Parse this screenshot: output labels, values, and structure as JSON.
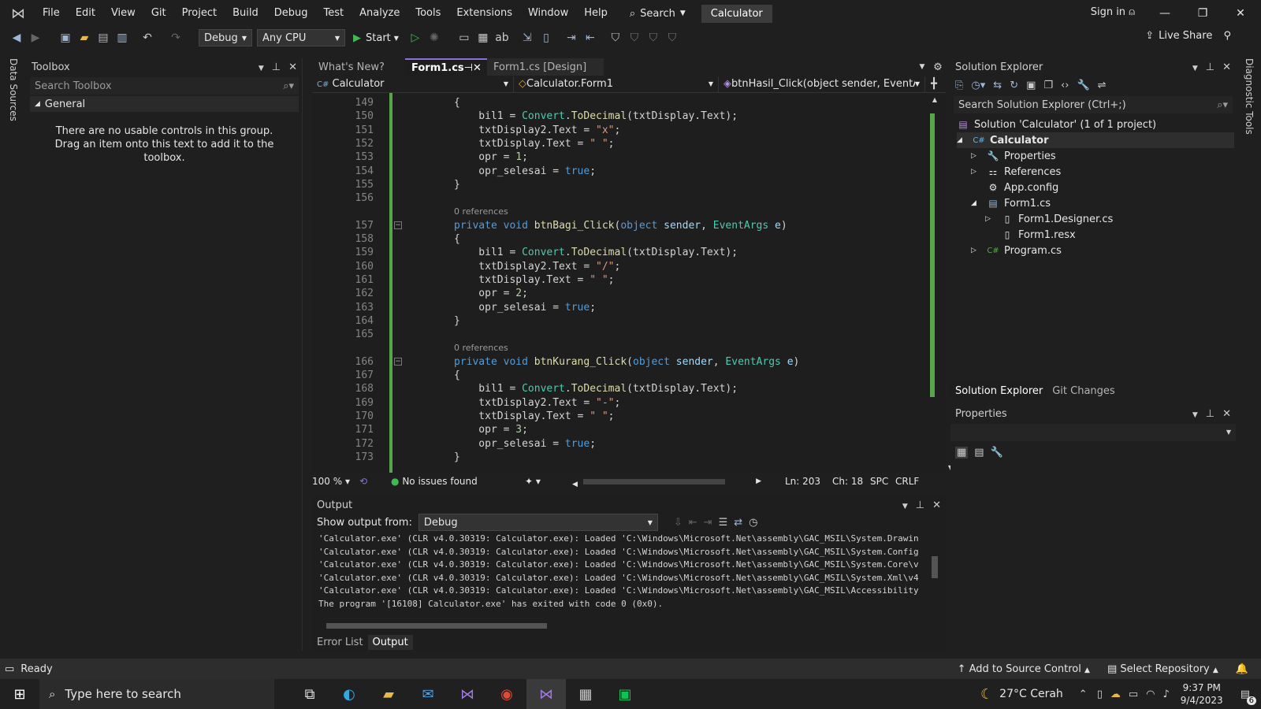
{
  "titlebar": {
    "menu": [
      "File",
      "Edit",
      "View",
      "Git",
      "Project",
      "Build",
      "Debug",
      "Test",
      "Analyze",
      "Tools",
      "Extensions",
      "Window",
      "Help"
    ],
    "search_label": "Search",
    "app_name": "Calculator",
    "sign_in": "Sign in"
  },
  "toolbar": {
    "config": "Debug",
    "platform": "Any CPU",
    "start": "Start",
    "live_share": "Live Share"
  },
  "side_strips": {
    "left": "Data Sources",
    "right": "Diagnostic Tools"
  },
  "toolbox": {
    "title": "Toolbox",
    "search_placeholder": "Search Toolbox",
    "group": "General",
    "message": "There are no usable controls in this group. Drag an item onto this text to add it to the toolbox."
  },
  "editor": {
    "tabs": [
      {
        "label": "What's New?"
      },
      {
        "label": "Form1.cs"
      },
      {
        "label": "Form1.cs [Design]"
      }
    ],
    "nav": {
      "project": "Calculator",
      "class": "Calculator.Form1",
      "member": "btnHasil_Click(object sender, EventArgs"
    },
    "code_lines": [
      {
        "n": "149",
        "t": "{"
      },
      {
        "n": "150",
        "t": "    bil1 = Convert.ToDecimal(txtDisplay.Text);"
      },
      {
        "n": "151",
        "t": "    txtDisplay2.Text = \"x\";"
      },
      {
        "n": "152",
        "t": "    txtDisplay.Text = \" \";"
      },
      {
        "n": "153",
        "t": "    opr = 1;"
      },
      {
        "n": "154",
        "t": "    opr_selesai = true;"
      },
      {
        "n": "155",
        "t": "}"
      },
      {
        "n": "156",
        "t": ""
      },
      {
        "n": "",
        "t": "0 references"
      },
      {
        "n": "157",
        "t": "private void btnBagi_Click(object sender, EventArgs e)"
      },
      {
        "n": "158",
        "t": "{"
      },
      {
        "n": "159",
        "t": "    bil1 = Convert.ToDecimal(txtDisplay.Text);"
      },
      {
        "n": "160",
        "t": "    txtDisplay2.Text = \"/\";"
      },
      {
        "n": "161",
        "t": "    txtDisplay.Text = \" \";"
      },
      {
        "n": "162",
        "t": "    opr = 2;"
      },
      {
        "n": "163",
        "t": "    opr_selesai = true;"
      },
      {
        "n": "164",
        "t": "}"
      },
      {
        "n": "165",
        "t": ""
      },
      {
        "n": "",
        "t": "0 references"
      },
      {
        "n": "166",
        "t": "private void btnKurang_Click(object sender, EventArgs e)"
      },
      {
        "n": "167",
        "t": "{"
      },
      {
        "n": "168",
        "t": "    bil1 = Convert.ToDecimal(txtDisplay.Text);"
      },
      {
        "n": "169",
        "t": "    txtDisplay2.Text = \"-\";"
      },
      {
        "n": "170",
        "t": "    txtDisplay.Text = \" \";"
      },
      {
        "n": "171",
        "t": "    opr = 3;"
      },
      {
        "n": "172",
        "t": "    opr_selesai = true;"
      },
      {
        "n": "173",
        "t": "}"
      }
    ],
    "status": {
      "zoom": "100 %",
      "issues": "No issues found",
      "ln": "Ln: 203",
      "ch": "Ch: 18",
      "spc": "SPC",
      "eol": "CRLF"
    }
  },
  "solution_explorer": {
    "title": "Solution Explorer",
    "search_placeholder": "Search Solution Explorer (Ctrl+;)",
    "items": [
      {
        "label": "Solution 'Calculator' (1 of 1 project)",
        "icon": "solution-icon",
        "expander": ""
      },
      {
        "label": "Calculator",
        "icon": "csharp-project-icon",
        "expander": "◢"
      },
      {
        "label": "Properties",
        "icon": "wrench-icon",
        "expander": "▷"
      },
      {
        "label": "References",
        "icon": "references-icon",
        "expander": "▷"
      },
      {
        "label": "App.config",
        "icon": "config-file-icon",
        "expander": ""
      },
      {
        "label": "Form1.cs",
        "icon": "form-icon",
        "expander": "◢"
      },
      {
        "label": "Form1.Designer.cs",
        "icon": "code-file-icon",
        "expander": "▷"
      },
      {
        "label": "Form1.resx",
        "icon": "resx-file-icon",
        "expander": ""
      },
      {
        "label": "Program.cs",
        "icon": "csharp-file-icon",
        "expander": "▷"
      }
    ],
    "tabs": [
      "Solution Explorer",
      "Git Changes"
    ]
  },
  "properties": {
    "title": "Properties"
  },
  "output": {
    "title": "Output",
    "show_from_label": "Show output from:",
    "source": "Debug",
    "lines": [
      "'Calculator.exe' (CLR v4.0.30319: Calculator.exe): Loaded 'C:\\Windows\\Microsoft.Net\\assembly\\GAC_MSIL\\System.Drawin",
      "'Calculator.exe' (CLR v4.0.30319: Calculator.exe): Loaded 'C:\\Windows\\Microsoft.Net\\assembly\\GAC_MSIL\\System.Config",
      "'Calculator.exe' (CLR v4.0.30319: Calculator.exe): Loaded 'C:\\Windows\\Microsoft.Net\\assembly\\GAC_MSIL\\System.Core\\v",
      "'Calculator.exe' (CLR v4.0.30319: Calculator.exe): Loaded 'C:\\Windows\\Microsoft.Net\\assembly\\GAC_MSIL\\System.Xml\\v4",
      "'Calculator.exe' (CLR v4.0.30319: Calculator.exe): Loaded 'C:\\Windows\\Microsoft.Net\\assembly\\GAC_MSIL\\Accessibility",
      "The program '[16108] Calculator.exe' has exited with code 0 (0x0)."
    ],
    "bottom_tabs": [
      "Error List",
      "Output"
    ]
  },
  "statusbar": {
    "ready": "Ready",
    "source_control": "Add to Source Control",
    "repo": "Select Repository"
  },
  "taskbar": {
    "search_placeholder": "Type here to search",
    "weather": "27°C  Cerah",
    "time": "9:37 PM",
    "date": "9/4/2023",
    "notifications": "6"
  },
  "colors": {
    "accent": "#8d6fd9",
    "keyword": "#569cd6",
    "type": "#4ec9b0",
    "string": "#d69d85",
    "green_change": "#57a64a"
  }
}
